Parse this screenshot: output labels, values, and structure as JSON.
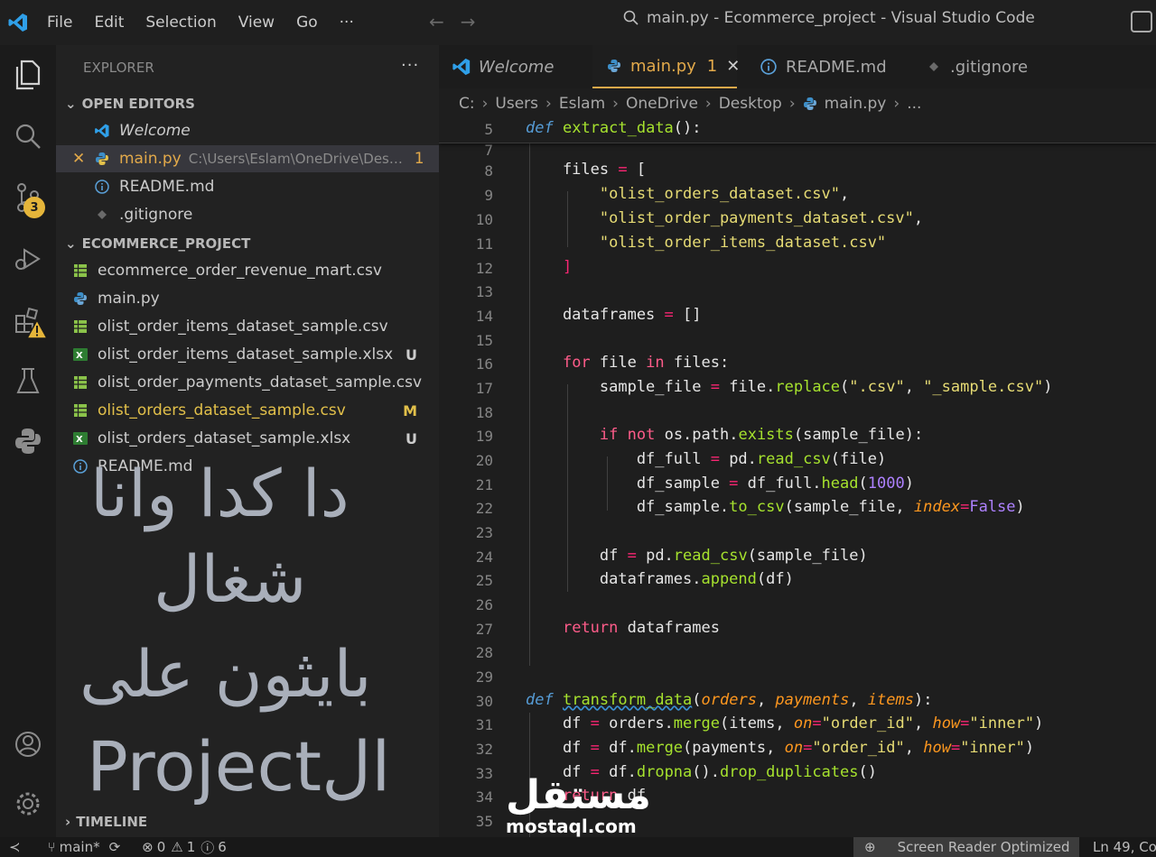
{
  "menu": [
    "File",
    "Edit",
    "Selection",
    "View",
    "Go",
    "···"
  ],
  "command_center": "main.py - Ecommerce_project - Visual Studio Code",
  "activity": {
    "source_control_badge": "3"
  },
  "explorer": {
    "title": "EXPLORER",
    "more": "···",
    "open_editors_label": "OPEN EDITORS",
    "open_editors": [
      {
        "name": "Welcome",
        "icon": "vscode-icon",
        "status": "",
        "path": "",
        "close": ""
      },
      {
        "name": "main.py",
        "icon": "python-icon",
        "status": "1",
        "path": "C:\\Users\\Eslam\\OneDrive\\Deskt...",
        "close": "✕"
      },
      {
        "name": "README.md",
        "icon": "info-icon",
        "status": "",
        "path": "",
        "close": ""
      },
      {
        "name": ".gitignore",
        "icon": "git-icon",
        "status": "",
        "path": "",
        "close": ""
      }
    ],
    "project_label": "ECOMMERCE_PROJECT",
    "files": [
      {
        "name": "ecommerce_order_revenue_mart.csv",
        "icon": "csv-icon",
        "status": ""
      },
      {
        "name": "main.py",
        "icon": "python-icon",
        "status": ""
      },
      {
        "name": "olist_order_items_dataset_sample.csv",
        "icon": "csv-icon",
        "status": ""
      },
      {
        "name": "olist_order_items_dataset_sample.xlsx",
        "icon": "excel-icon",
        "status": "U"
      },
      {
        "name": "olist_order_payments_dataset_sample.csv",
        "icon": "csv-icon",
        "status": ""
      },
      {
        "name": "olist_orders_dataset_sample.csv",
        "icon": "csv-icon",
        "status": "M"
      },
      {
        "name": "olist_orders_dataset_sample.xlsx",
        "icon": "excel-icon",
        "status": "U"
      },
      {
        "name": "README.md",
        "icon": "info-icon",
        "status": ""
      }
    ],
    "timeline_label": "TIMELINE"
  },
  "overlay_text": [
    "دا كدا وانا",
    "شغال",
    "بايثون على",
    "Projectال"
  ],
  "tabs": [
    {
      "label": "Welcome",
      "badge": "",
      "close": ""
    },
    {
      "label": "main.py",
      "badge": "1",
      "close": "✕"
    },
    {
      "label": "README.md",
      "badge": "",
      "close": ""
    },
    {
      "label": ".gitignore",
      "badge": "",
      "close": ""
    }
  ],
  "breadcrumb": [
    "C:",
    "Users",
    "Eslam",
    "OneDrive",
    "Desktop",
    "main.py",
    "..."
  ],
  "sticky": {
    "line": "5"
  },
  "watermark": {
    "arabic": "مستقل",
    "latin": "mostaql.com"
  },
  "statusbar": {
    "branch": "main*",
    "errors": "0",
    "warnings": "1",
    "infos": "6",
    "screen_reader": "Screen Reader Optimized",
    "position": "Ln 49, Co"
  }
}
